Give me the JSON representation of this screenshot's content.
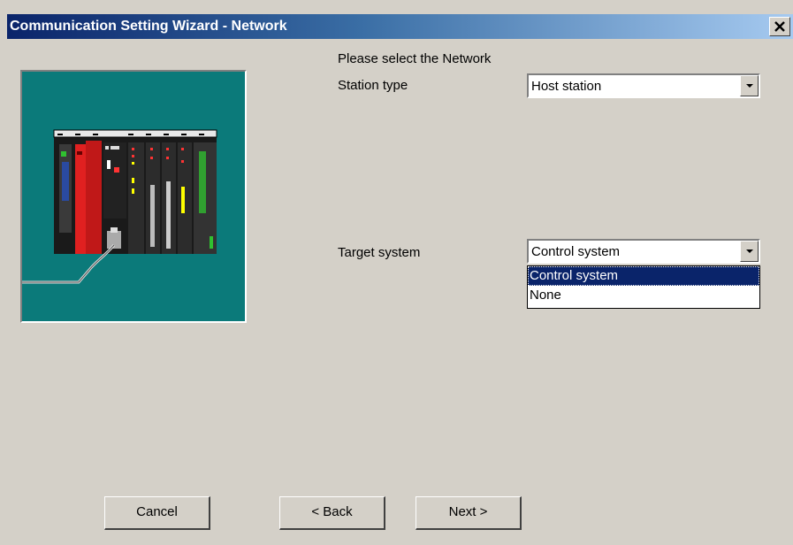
{
  "window": {
    "title": "Communication Setting Wizard - Network",
    "close_glyph": "✕"
  },
  "main": {
    "instruction": "Please select the Network",
    "station_type": {
      "label": "Station type",
      "value": "Host station"
    },
    "target_system": {
      "label": "Target system",
      "value": "Control system",
      "options": [
        "Control system",
        "None"
      ],
      "selected_option": "Control system"
    }
  },
  "buttons": {
    "cancel": "Cancel",
    "back": "< Back",
    "next": "Next >"
  },
  "colors": {
    "titlebar_start": "#0a246a",
    "titlebar_end": "#a6caf0",
    "dialog_background": "#d4d0c8",
    "image_background": "#0b7a7a",
    "selection": "#0a246a"
  }
}
